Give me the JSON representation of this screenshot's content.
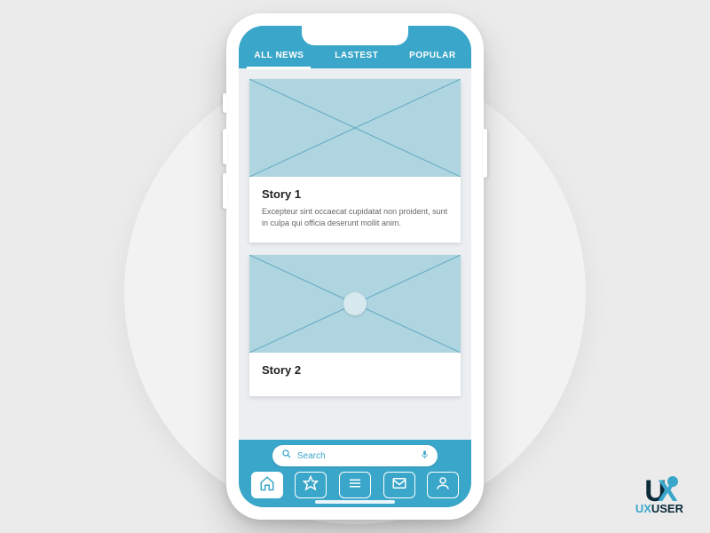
{
  "colors": {
    "accent": "#3aa6c9",
    "dark": "#0b2a3a"
  },
  "tabs": [
    {
      "label": "ALL NEWS",
      "active": true
    },
    {
      "label": "LASTEST",
      "active": false
    },
    {
      "label": "POPULAR",
      "active": false
    }
  ],
  "stories": [
    {
      "title": "Story 1",
      "body": "Excepteur sint occaecat cupidatat non proident, sunt in culpa qui officia deserunt mollit anim."
    },
    {
      "title": "Story 2",
      "body": ""
    }
  ],
  "search": {
    "placeholder": "Search"
  },
  "nav": [
    {
      "name": "home-icon",
      "active": true
    },
    {
      "name": "star-icon",
      "active": false
    },
    {
      "name": "menu-icon",
      "active": false
    },
    {
      "name": "mail-icon",
      "active": false
    },
    {
      "name": "user-icon",
      "active": false
    }
  ],
  "logo": {
    "prefix": "UX",
    "suffix": "USER"
  }
}
